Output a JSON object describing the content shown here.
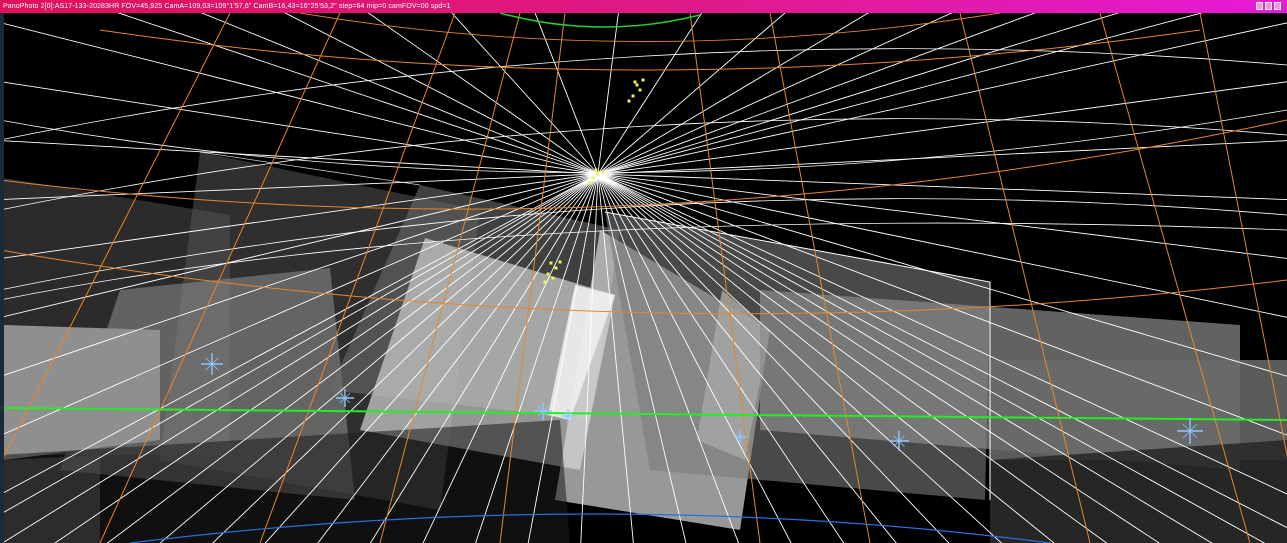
{
  "window": {
    "title": "PanoPhoto 2[0]:AS17-133-20283HR FOV=45,925 CamA=109,03=109°1'57,6\" CamB=16,43=16°25'53,2\" step=64 mip=0 camFOV=00 spd=1"
  },
  "colors": {
    "titlebar_start": "#e0105a",
    "titlebar_end": "#e61ad8",
    "grid_white": "#ffffff",
    "grid_orange": "#e8862a",
    "horizon_green": "#22ee22",
    "zenith_green": "#22cc33",
    "nadir_blue": "#2a6fe0",
    "control_point": "#8ec8ff",
    "marker_yellow": "#f2f250"
  },
  "icons": {
    "window_buttons": [
      "minimize-icon",
      "maximize-icon",
      "close-icon"
    ],
    "control_points": "crosshair-icon",
    "markers": "yellow-marker-icon"
  }
}
